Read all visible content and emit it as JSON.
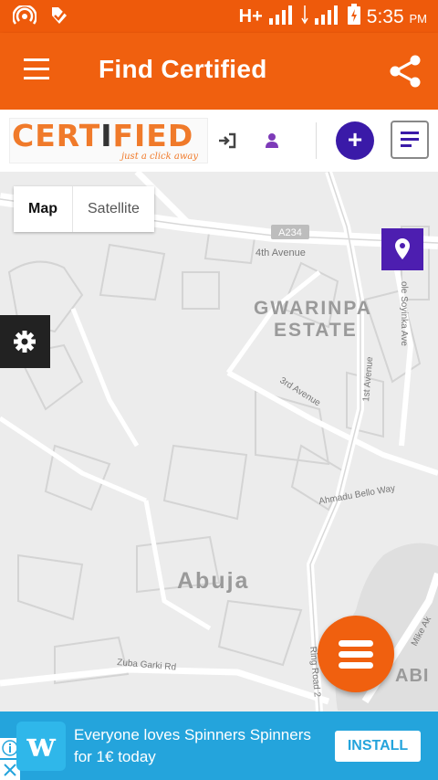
{
  "status_bar": {
    "network": "H+",
    "time": "5:35",
    "ampm": "PM"
  },
  "app_bar": {
    "title": "Find Certified"
  },
  "toolbar": {
    "logo": {
      "text_left": "CERT",
      "text_mid": "I",
      "text_right": "FIED",
      "tagline": "just a click away"
    }
  },
  "map": {
    "type_buttons": [
      {
        "label": "Map",
        "active": true
      },
      {
        "label": "Satellite",
        "active": false
      }
    ],
    "labels": {
      "route_badge": "A234",
      "fourth_ave": "4th Avenue",
      "area1": "GWARINPA",
      "area2": "ESTATE",
      "soyinka": "ole Soyinka Ave",
      "first_ave": "1st Avenue",
      "third_ave": "3rd Avenue",
      "ahmadu": "Ahmadu Bello Way",
      "city": "Abuja",
      "zuba": "Zuba Garki Rd",
      "ring_road": "Ring Road 2",
      "mike": "Mike Ak",
      "abi": "ABI"
    }
  },
  "ad": {
    "brand_letter": "w",
    "text": "Everyone loves Spinners Spinners for 1€ today",
    "install_label": "INSTALL"
  },
  "colors": {
    "primary": "#f0600f",
    "status_bar": "#ee5a0b",
    "accent_purple": "#4d1eb0",
    "ad_blue": "#24a4dc"
  }
}
